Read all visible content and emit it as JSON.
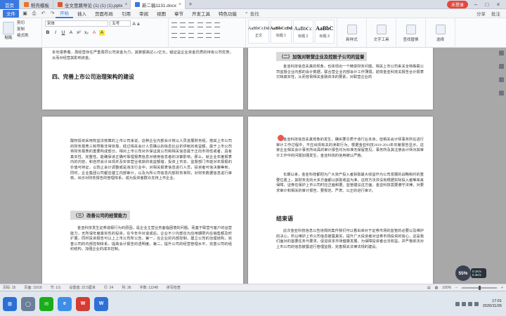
{
  "tabs": [
    {
      "label": "首页",
      "kind": "home"
    },
    {
      "label": "稻壳模板",
      "kind": "normal",
      "color": "#e8742c"
    },
    {
      "label": "全文思路导论 (1) (1) (1).pptx",
      "kind": "normal",
      "color": "#d85a2a"
    },
    {
      "label": "新二稿1131.docx",
      "kind": "active",
      "color": "#3b79e0"
    }
  ],
  "titlebar": {
    "login": "未登录"
  },
  "menu": {
    "file": "文件",
    "items": [
      "开始",
      "插入",
      "页面布局",
      "引用",
      "审阅",
      "视图",
      "章节",
      "开发工具",
      "特色功能"
    ],
    "active": "开始",
    "search": "查找",
    "right": [
      "分享",
      "批注"
    ]
  },
  "ribbon": {
    "clipboard": {
      "paste": "粘贴",
      "cut": "剪切",
      "copy": "复制",
      "format": "格式刷"
    },
    "font": {
      "name": "宋体",
      "size": "五号",
      "buttons": [
        "B",
        "I",
        "U",
        "A",
        "x²",
        "x₂",
        "A",
        "A"
      ]
    },
    "styles": [
      {
        "sample": "AaBbCcDd",
        "name": "正文"
      },
      {
        "sample": "AaBbCcDd",
        "name": "标题 1"
      },
      {
        "sample": "AaBbCc",
        "name": "标题 2"
      },
      {
        "sample": "AaBbC",
        "name": "标题 3"
      }
    ],
    "tools": [
      "新样式",
      "文字工具",
      "查找替换",
      "选择"
    ]
  },
  "pages": {
    "p1": {
      "text1": "本年报表看，周经营存在严重周同公司资金为力，其数额高达3.2亿元，错证益企业资金优质的持有公司优势，从而对经营其影响资金。",
      "heading": "四、完善上市公司治理架构的建设"
    },
    "p2": {
      "heading": "（二）加强对联营企业及控股子公司的监督",
      "text1": "金亚科技信息失真的现象，也体现出一个精变财务问题，相关上市公司来关全特殊联公司监督企业内部的会计数据，联合营企业内部会计工作薄弱，前突金亚科技关报告合计报表欠缺真实性，从而容易相关金融资本的要素，对联营企业的"
    },
    "p3": {
      "text1": "酸权投资采用权益法核算的上市公司来说，这种企业内部会计核以人员进展财务组，搭其上市公司的财务报表三和导致非常依靠，经过相关会计人员确认的信息比业折供帐的收益额，属于上市公司将财务报表的重要构成部分。相对上市公司对外保证其公司和相关信息属于正向市场性或者，具有真实性、完整性。能确保该正确可靠理报表信息对使用信息者的决策影响，那么，就企业年度报表内的内容，和自然会计出现并及实体营业收获的收益额错，投资上市去、监督部门市能对年报报的价值可持证，以防止会计调整或是违法行业中，对相关报表信息进行人员，投资者可信决策等到，同时，企业集团公司都应建立内部审计，以及为所公司信息内部财务准则，对财务数据信息进行审核，出示对财务报告的管理体系，成为投资者群众支持上市企业。",
      "heading": "（三）改善公司的经营能力",
      "text2": "金亚科技发生证券造假行为的原因，是企业主营业务面临困境的问题。而基于联营与客户的运营能力，无所谓年度真实性的投资，在今年中对造成后，企业不少内部应为应用期限内在销售额及时扩展，同时投资报告可以上上市公司所公告，第一，在企业的内部控制，建立公司的治理结构，完善公司的内部控制体系，提高会计报告的透明度。第二，提升公司的经营管理水平，完善公司的组织结构，加强企业的成本控制。"
    },
    "p4": {
      "text1": "金亚科技信息失真现象的发生，确实要引质于该行业本身，但相关会计师事务所在进行审计工作过程中，不应出现有关的渎职行为。根据金亚科技2010-2014年年度报告显示，这家企业相关会计事务所出具的审计报告均为标准无保留意见。事务所及其注册会计师对其审计工作中的问题加强发生，金亚科技的信用被以严格。",
      "text2": "长期以来，金亚科技都把为广大资产投入者获取最大收益作为公司发展的战略和约的重要位置上，其财务支的大多方面都以获取收益为准，这样方法并没有根据实际投入者等来来保障，证券在保护上市公司时应正面和要。监管建议这方面，金亚科技需要遵守法律，对要求审计和相关的审计报告，要规范、严肃、公正的进行审计。",
      "heading": "结束语",
      "text3": "此次金亚科技信息公告违规的案件我们可以看出来对于证券市场的监管的必要以及维护的决心，所以维护上市公司信息披露真实，提升广大投资者对证券市场投资的信心，这是我们面对的首要任务与要求。促进资本市场健康发展，为保障投资者合法权益，并严格依法对上市公司的信息披露进行管理监督，完善相关法律法规的建设。"
    }
  },
  "statusbar": {
    "left": [
      "页码: 15",
      "页面: 15/16",
      "节: 1/1",
      "设置值: 22.5厘米",
      "行: 24",
      "列: 36",
      "字数: 11248",
      "拼写检查"
    ],
    "zoom": "100%"
  },
  "floating": {
    "speed": "55%",
    "net_up": "0.1K/s",
    "net_down": "0.3K/s"
  },
  "taskbar": {
    "icons": [
      {
        "name": "start",
        "color": "#2b6fd6",
        "glyph": "⊞"
      },
      {
        "name": "search",
        "color": "#6a7f99",
        "glyph": "◯"
      },
      {
        "name": "chat",
        "color": "#1aad19",
        "glyph": "✉"
      },
      {
        "name": "browser",
        "color": "#3e8ee8",
        "glyph": "e"
      },
      {
        "name": "wps",
        "color": "#d43b32",
        "glyph": "W"
      },
      {
        "name": "wps-writer",
        "color": "#2f6fd8",
        "glyph": "W"
      }
    ],
    "time": "17:01",
    "date": "2020/11/26"
  }
}
